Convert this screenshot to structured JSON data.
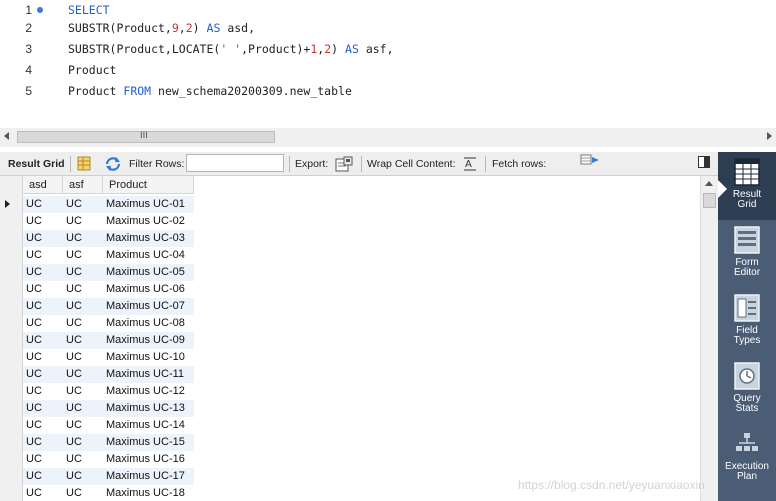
{
  "editor": {
    "lines": [
      {
        "number": "1",
        "text": "SELECT"
      },
      {
        "number": "2",
        "text": "SUBSTR(Product,9,2) AS asd,"
      },
      {
        "number": "3",
        "text": "SUBSTR(Product,LOCATE(' ',Product)+1,2) AS asf,"
      },
      {
        "number": "4",
        "text": "Product"
      },
      {
        "number": "5",
        "text": "Product FROM new_schema20200309.new_table"
      }
    ],
    "line2_parts": {
      "fn": "SUBSTR(Product,",
      "n1": "9",
      "comma": ",",
      "n2": "2",
      "close": ") ",
      "as": "AS",
      "alias": " asd,"
    },
    "line3_parts": {
      "fn": "SUBSTR(Product,LOCATE(",
      "str": "' '",
      "mid": ",Product)+",
      "n1": "1",
      "comma": ",",
      "n2": "2",
      "close": ") ",
      "as": "AS",
      "alias": " asf,"
    },
    "line5_parts": {
      "col": "Product ",
      "from": "FROM",
      "table": " new_schema20200309.new_table"
    }
  },
  "hscroll": {
    "grip": "III"
  },
  "toolbar": {
    "result_grid_label": "Result Grid",
    "filter_rows_label": "Filter Rows:",
    "filter_rows_value": "",
    "export_label": "Export:",
    "wrap_label": "Wrap Cell Content:",
    "fetch_label": "Fetch rows:"
  },
  "grid": {
    "columns": [
      "asd",
      "asf",
      "Product"
    ],
    "rows": [
      [
        "UC",
        "UC",
        "Maximus UC-01"
      ],
      [
        "UC",
        "UC",
        "Maximus UC-02"
      ],
      [
        "UC",
        "UC",
        "Maximus UC-03"
      ],
      [
        "UC",
        "UC",
        "Maximus UC-04"
      ],
      [
        "UC",
        "UC",
        "Maximus UC-05"
      ],
      [
        "UC",
        "UC",
        "Maximus UC-06"
      ],
      [
        "UC",
        "UC",
        "Maximus UC-07"
      ],
      [
        "UC",
        "UC",
        "Maximus UC-08"
      ],
      [
        "UC",
        "UC",
        "Maximus UC-09"
      ],
      [
        "UC",
        "UC",
        "Maximus UC-10"
      ],
      [
        "UC",
        "UC",
        "Maximus UC-11"
      ],
      [
        "UC",
        "UC",
        "Maximus UC-12"
      ],
      [
        "UC",
        "UC",
        "Maximus UC-13"
      ],
      [
        "UC",
        "UC",
        "Maximus UC-14"
      ],
      [
        "UC",
        "UC",
        "Maximus UC-15"
      ],
      [
        "UC",
        "UC",
        "Maximus UC-16"
      ],
      [
        "UC",
        "UC",
        "Maximus UC-17"
      ],
      [
        "UC",
        "UC",
        "Maximus UC-18"
      ]
    ]
  },
  "side_panel": {
    "buttons": [
      {
        "line1": "Result",
        "line2": "Grid",
        "icon": "result-grid-icon",
        "active": true
      },
      {
        "line1": "Form",
        "line2": "Editor",
        "icon": "form-editor-icon",
        "active": false
      },
      {
        "line1": "Field",
        "line2": "Types",
        "icon": "field-types-icon",
        "active": false
      },
      {
        "line1": "Query",
        "line2": "Stats",
        "icon": "query-stats-icon",
        "active": false
      },
      {
        "line1": "Execution",
        "line2": "Plan",
        "icon": "execution-plan-icon",
        "active": false
      }
    ]
  },
  "watermark": "https://blog.csdn.net/yeyuanxiaoxin",
  "colors": {
    "keyword": "#1f5fc9",
    "number": "#c3372f",
    "side_panel": "#4a5d74",
    "side_active": "#2d3e52"
  }
}
